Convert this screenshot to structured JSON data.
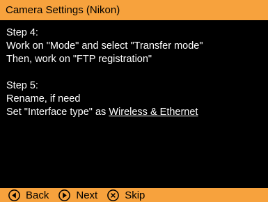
{
  "title": "Camera Settings (Nikon)",
  "step4": {
    "heading": "Step 4:",
    "line1_pre": "Work on \"Mode\" and select \"Transfer mode\"",
    "line2": "Then, work on \"FTP registration\""
  },
  "step5": {
    "heading": "Step 5:",
    "line1": "Rename, if need",
    "line2_pre": "Set \"Interface type\" as ",
    "line2_link": "Wireless & Ethernet"
  },
  "nav": {
    "back_label": "Back",
    "next_label": "Next",
    "skip_label": "Skip"
  },
  "colors": {
    "accent": "#f7a23d",
    "background": "#000000",
    "text": "#ffffff"
  },
  "icons": {
    "back": "circle-left-arrow-icon",
    "next": "circle-right-arrow-icon",
    "skip": "circle-x-icon"
  }
}
